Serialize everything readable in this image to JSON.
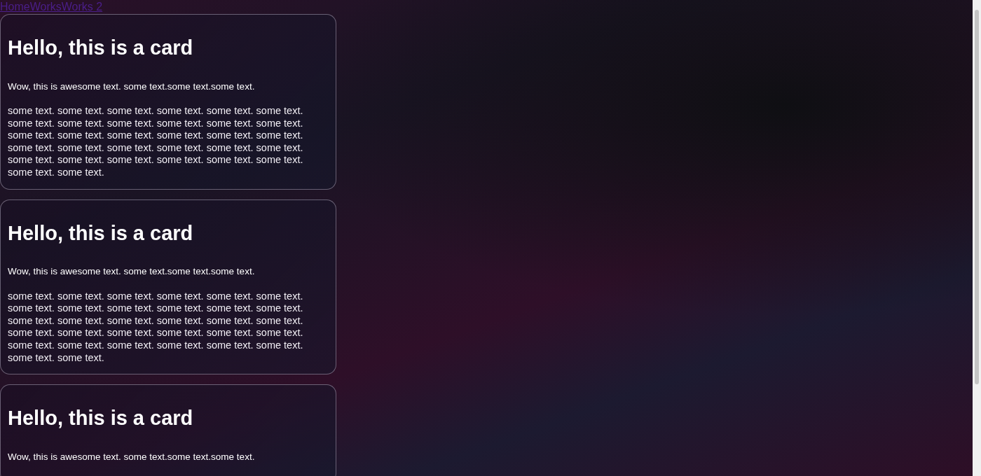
{
  "nav": {
    "links": [
      "Home",
      "Works",
      "Works 2"
    ]
  },
  "cards": [
    {
      "title": "Hello, this is a card",
      "subtitle": "Wow, this is awesome text. some text.some text.some text.",
      "body": "some text. some text. some text. some text. some text. some text. some text. some text. some text. some text. some text. some text. some text. some text. some text. some text. some text. some text. some text. some text. some text. some text. some text. some text. some text. some text. some text. some text. some text. some text. some text. some text."
    },
    {
      "title": "Hello, this is a card",
      "subtitle": "Wow, this is awesome text. some text.some text.some text.",
      "body": "some text. some text. some text. some text. some text. some text. some text. some text. some text. some text. some text. some text. some text. some text. some text. some text. some text. some text. some text. some text. some text. some text. some text. some text. some text. some text. some text. some text. some text. some text. some text. some text."
    },
    {
      "title": "Hello, this is a card",
      "subtitle": "Wow, this is awesome text. some text.some text.some text."
    }
  ]
}
